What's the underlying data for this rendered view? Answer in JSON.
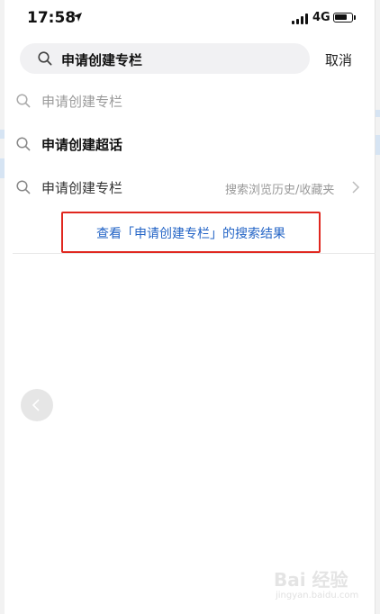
{
  "status_bar": {
    "time": "17:58",
    "network": "4G"
  },
  "search": {
    "query": "申请创建专栏",
    "cancel_label": "取消"
  },
  "suggestions": [
    {
      "label": "申请创建专栏",
      "style": "muted"
    },
    {
      "label": "申请创建超话",
      "style": "strong"
    },
    {
      "label": "申请创建专栏",
      "style": "normal",
      "extra": "搜索浏览历史/收藏夹"
    }
  ],
  "result_link": "查看「申请创建专栏」的搜索结果",
  "watermark": {
    "brand": "Bai 经验",
    "url": "jingyan.baidu.com"
  },
  "colors": {
    "link": "#2364c6",
    "highlight_border": "#e0271f"
  }
}
